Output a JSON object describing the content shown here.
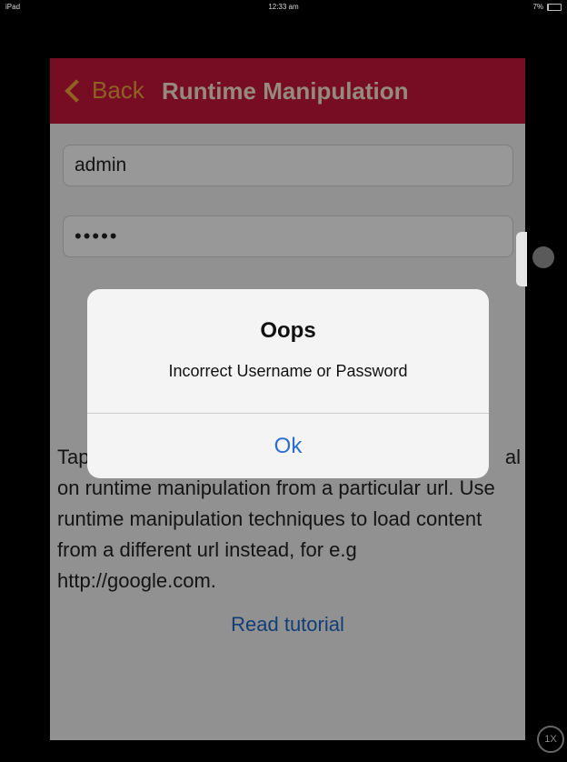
{
  "status_bar": {
    "device": "iPad",
    "time": "12:33 am",
    "battery": "7%"
  },
  "navbar": {
    "back_label": "Back",
    "title": "Runtime Manipulation"
  },
  "form": {
    "username_value": "admin",
    "password_value": "•••••"
  },
  "description": "Tap the button below to see a tutorial on runtime manipulation from a particular url. Use runtime manipulation techniques to load content from a different url instead, for e.g http://google.com.",
  "description_visible": {
    "line1_left": "Tap",
    "line1_right": "al",
    "rest": "on runtime manipulation from a particular url. Use runtime manipulation techniques to load content from a different url instead, for e.g http://google.com."
  },
  "read_tutorial_label": "Read tutorial",
  "alert": {
    "title": "Oops",
    "message": "Incorrect Username or Password",
    "button_label": "Ok"
  },
  "zoom_button_label": "1X",
  "colors": {
    "navbar": "#c5173a",
    "back": "#f0a03c",
    "link": "#1f66c4"
  }
}
